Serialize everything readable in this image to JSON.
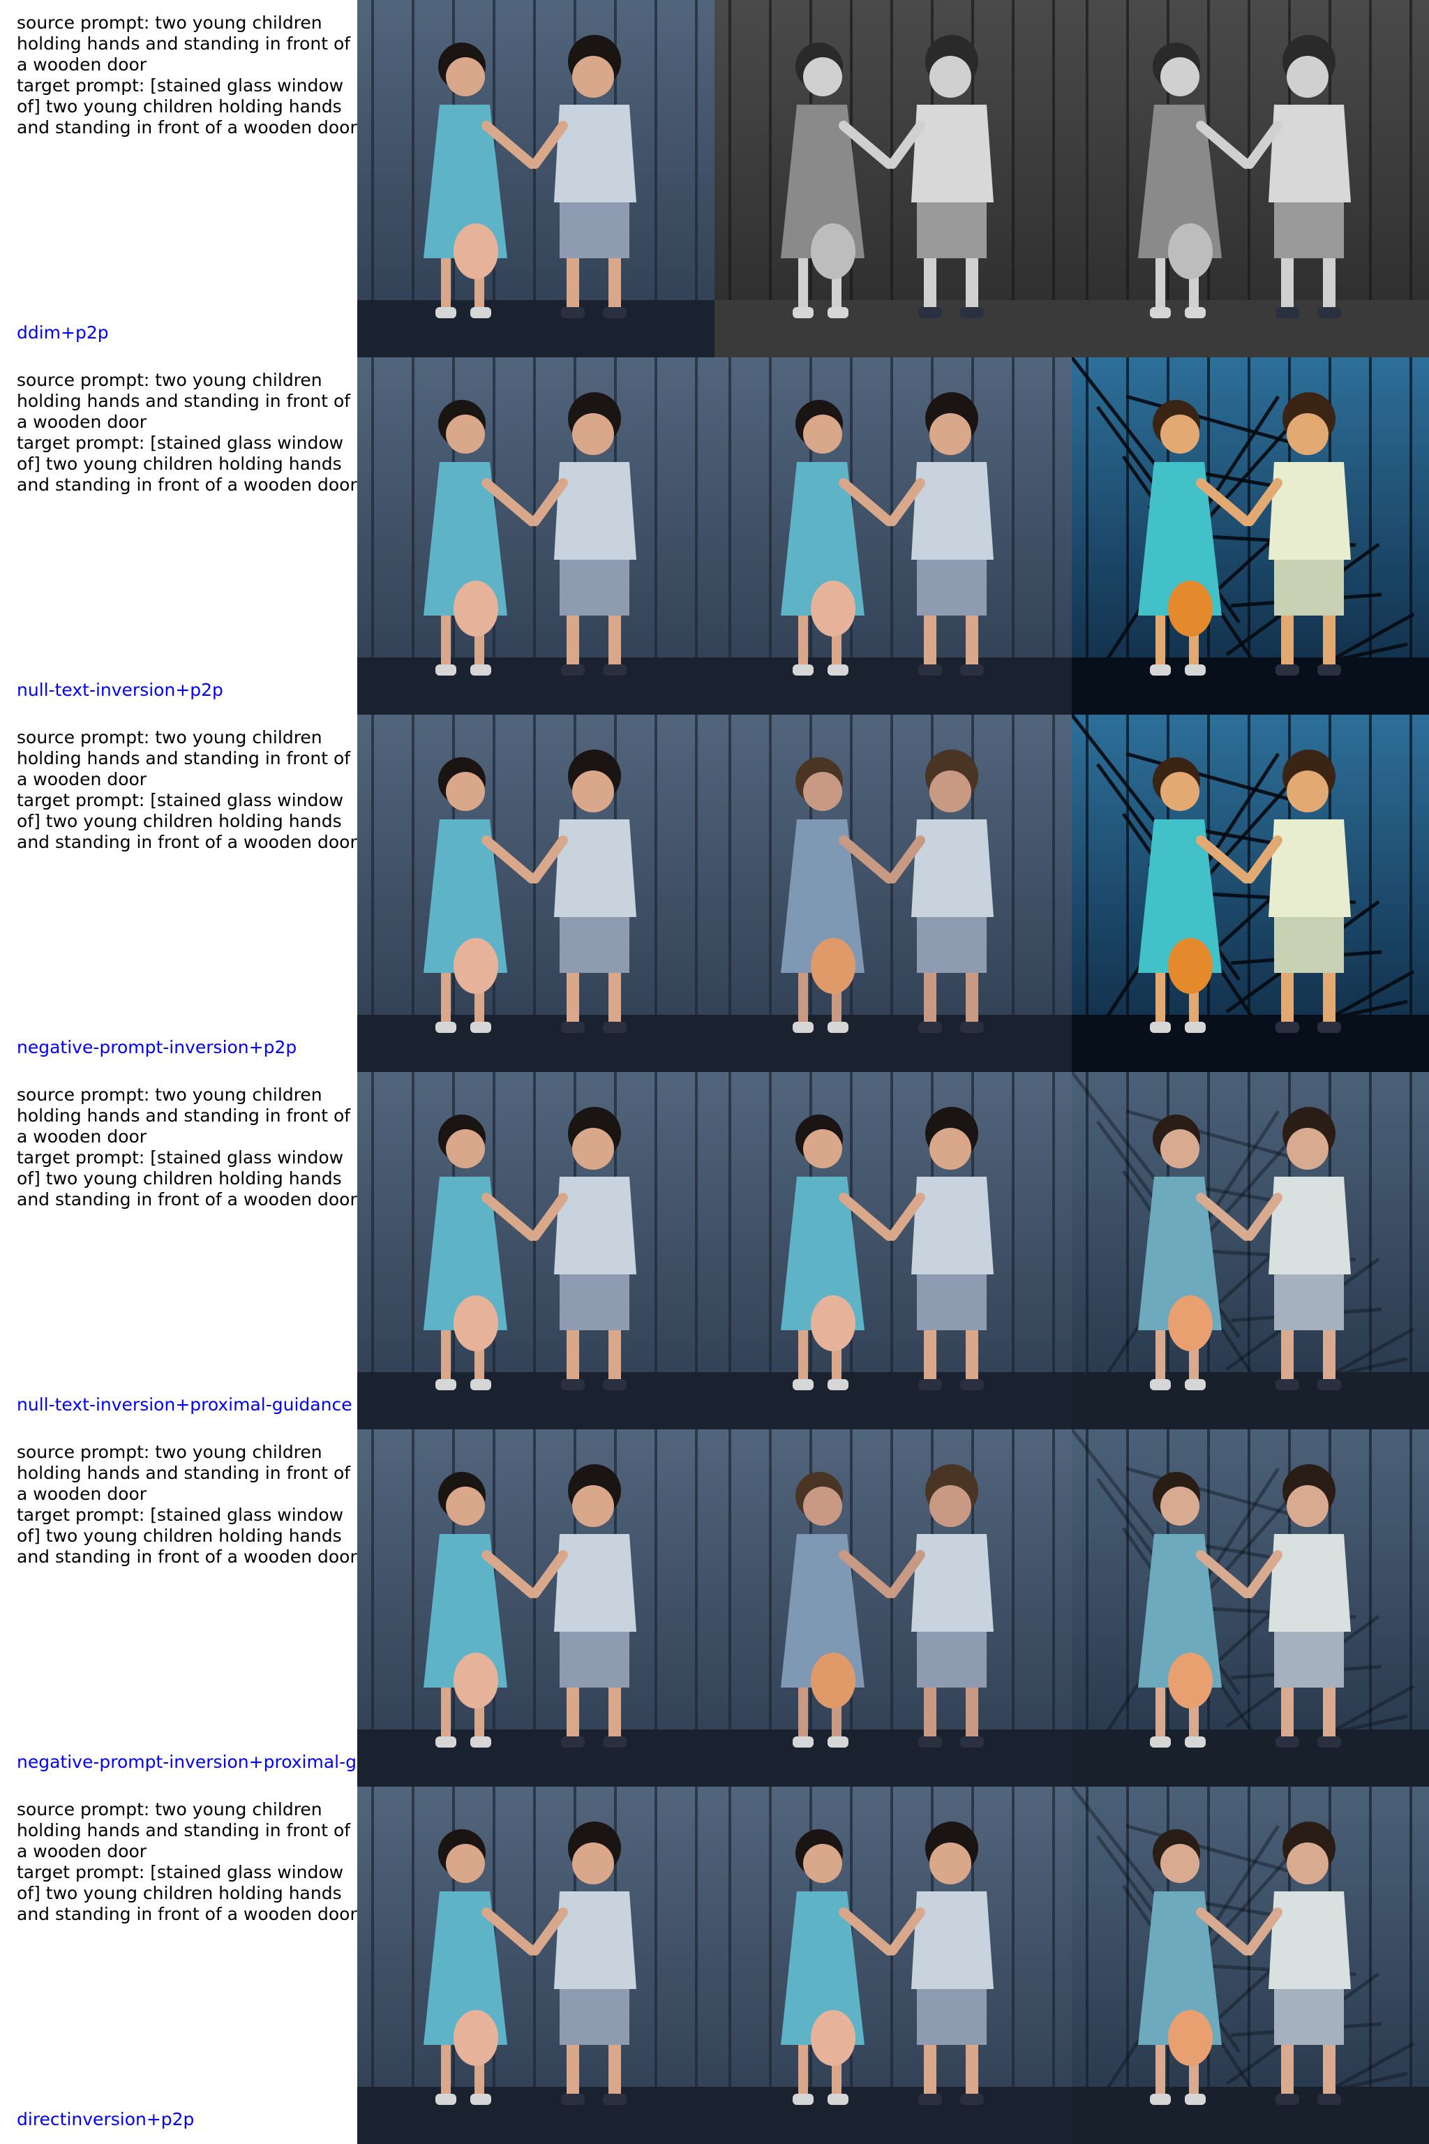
{
  "colors": {
    "method_label": "#0000ff",
    "prompt_text": "#000000",
    "scene_door": "#3a4a5e",
    "girl_dress": "#5fb3c7",
    "boy_shirt": "#c9d3dd"
  },
  "rows": [
    {
      "method": "ddim+p2p",
      "source_prompt": "source prompt: two young children holding hands and standing in front of a wooden door",
      "target_prompt": "target prompt: [stained glass window of] two young children holding hands and standing in front of a wooden door",
      "images": [
        "original",
        "grayscale",
        "grayscale"
      ]
    },
    {
      "method": "null-text-inversion+p2p",
      "source_prompt": "source prompt: two young children holding hands and standing in front of a wooden door",
      "target_prompt": "target prompt: [stained glass window of] two young children holding hands and standing in front of a wooden door",
      "images": [
        "original",
        "original",
        "stained-glass"
      ]
    },
    {
      "method": "negative-prompt-inversion+p2p",
      "source_prompt": "source prompt: two young children holding hands and standing in front of a wooden door",
      "target_prompt": "target prompt: [stained glass window of] two young children holding hands and standing in front of a wooden door",
      "images": [
        "original",
        "distorted",
        "stained-glass"
      ]
    },
    {
      "method": "null-text-inversion+proximal-guidance",
      "source_prompt": "source prompt: two young children holding hands and standing in front of a wooden door",
      "target_prompt": "target prompt: [stained glass window of] two young children holding hands and standing in front of a wooden door",
      "images": [
        "original",
        "original",
        "faint-glass"
      ]
    },
    {
      "method": "negative-prompt-inversion+proximal-g",
      "source_prompt": "source prompt: two young children holding hands and standing in front of a wooden door",
      "target_prompt": "target prompt: [stained glass window of] two young children holding hands and standing in front of a wooden door",
      "images": [
        "original",
        "distorted",
        "faint-glass"
      ]
    },
    {
      "method": "directinversion+p2p",
      "source_prompt": "source prompt: two young children holding hands and standing in front of a wooden door",
      "target_prompt": "target prompt: [stained glass window of] two young children holding hands and standing in front of a wooden door",
      "images": [
        "original",
        "original",
        "faint-glass"
      ]
    }
  ]
}
